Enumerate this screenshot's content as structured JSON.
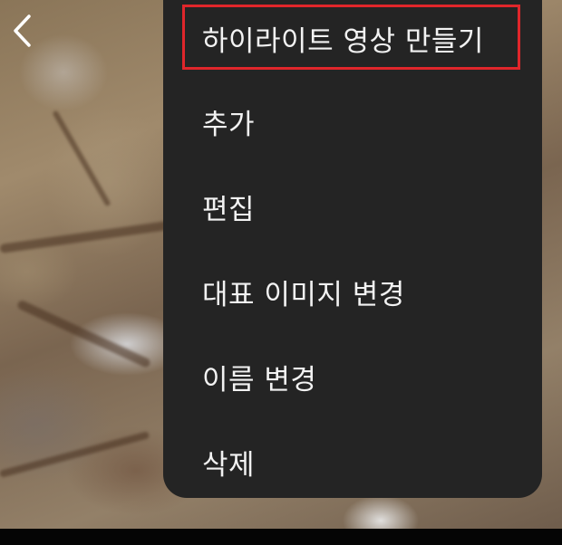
{
  "header": {
    "back_icon": "chevron-left-icon"
  },
  "menu": {
    "items": [
      {
        "label": "하이라이트 영상 만들기",
        "highlighted": true
      },
      {
        "label": "추가",
        "highlighted": false
      },
      {
        "label": "편집",
        "highlighted": false
      },
      {
        "label": "대표 이미지 변경",
        "highlighted": false
      },
      {
        "label": "이름 변경",
        "highlighted": false
      },
      {
        "label": "삭제",
        "highlighted": false
      }
    ]
  },
  "colors": {
    "menu_background": "#242424",
    "menu_text": "#f2f2f2",
    "highlight_border": "#e0262b"
  }
}
